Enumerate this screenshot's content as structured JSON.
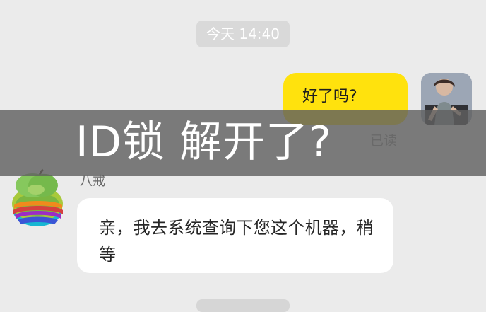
{
  "chat": {
    "timestamp": "今天 14:40",
    "outgoing": {
      "text": "好了吗?",
      "read_status": "已读"
    },
    "incoming": {
      "sender": "八戒",
      "text": "亲，我去系统查询下您这个机器，稍等"
    }
  },
  "overlay": {
    "title": "ID锁 解开了?"
  },
  "colors": {
    "background": "#ebebeb",
    "outgoing_bubble": "#ffe20d",
    "incoming_bubble": "#ffffff",
    "overlay": "#606060"
  }
}
